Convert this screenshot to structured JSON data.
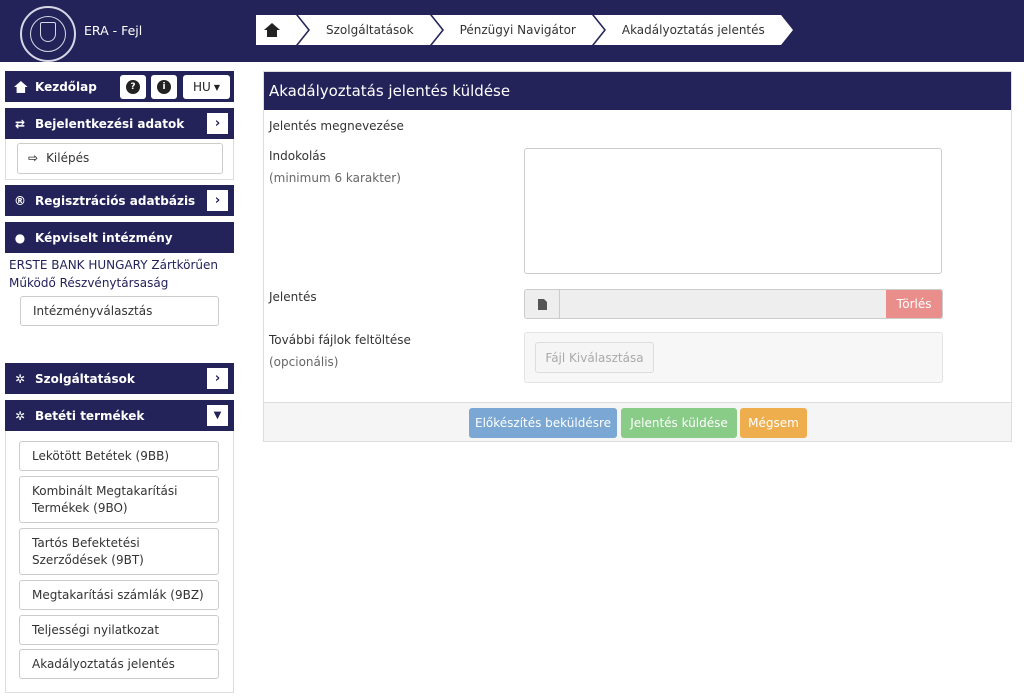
{
  "header": {
    "app_title": "ERA - Fejl",
    "breadcrumb": [
      "Szolgáltatások",
      "Pénzügyi Navigátor",
      "Akadályoztatás jelentés"
    ]
  },
  "sidebar": {
    "home_label": "Kezdőlap",
    "language": "HU",
    "login_data_label": "Bejelentkezési adatok",
    "logout_label": "Kilépés",
    "registration_db_label": "Regisztrációs adatbázis",
    "represented_institution_label": "Képviselt intézmény",
    "institution_name": "ERSTE BANK HUNGARY Zártkörűen Működő Részvénytársaság",
    "institution_select_label": "Intézményválasztás",
    "services_label": "Szolgáltatások",
    "deposit_products_label": "Betéti termékek",
    "deposit_items": [
      "Lekötött Betétek (9BB)",
      "Kombinált Megtakarítási Termékek (9BO)",
      "Tartós Befektetési Szerződések (9BT)",
      "Megtakarítási számlák (9BZ)",
      "Teljességi nyilatkozat",
      "Akadályoztatás jelentés"
    ]
  },
  "main": {
    "title": "Akadályoztatás jelentés küldése",
    "report_name_label": "Jelentés megnevezése",
    "reason_label": "Indokolás",
    "reason_hint": "(minimum 6 karakter)",
    "reason_value": "",
    "report_label": "Jelentés",
    "report_file_value": "",
    "delete_label": "Törlés",
    "extra_files_label": "További fájlok feltöltése",
    "extra_files_hint": "(opcionális)",
    "choose_file_label": "Fájl Kiválasztása",
    "prepare_label": "Előkészítés beküldésre",
    "send_label": "Jelentés küldése",
    "cancel_label": "Mégsem"
  },
  "colors": {
    "navy": "#23235a",
    "prepare": "#7aa7d3",
    "send": "#88cc88",
    "cancel": "#efae4e",
    "delete": "#e98e8b"
  }
}
